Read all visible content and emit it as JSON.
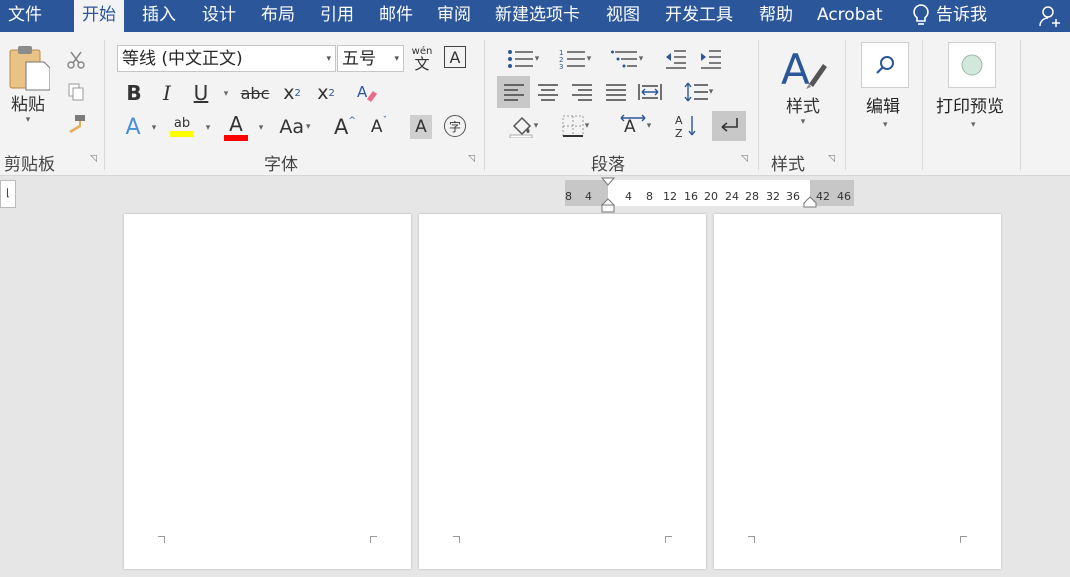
{
  "menu": {
    "tabs": [
      "文件",
      "开始",
      "插入",
      "设计",
      "布局",
      "引用",
      "邮件",
      "审阅",
      "新建选项卡",
      "视图",
      "开发工具",
      "帮助",
      "Acrobat"
    ],
    "tell_me": "告诉我"
  },
  "clipboard": {
    "paste": "粘贴",
    "group": "剪贴板"
  },
  "font": {
    "name": "等线 (中文正文)",
    "size": "五号",
    "phonetic_top": "wén",
    "phonetic_bottom": "文",
    "border_char": "A",
    "bold": "B",
    "italic": "I",
    "underline": "U",
    "strike": "abc",
    "subscript": "x",
    "sub_mark": "2",
    "superscript": "x",
    "sup_mark": "2",
    "text_effect": "A",
    "highlight": "ab",
    "font_color": "A",
    "case": "Aa",
    "grow": "A",
    "shrink": "A",
    "shading": "A",
    "enclose": "字",
    "group": "字体"
  },
  "paragraph": {
    "group": "段落"
  },
  "styles": {
    "label": "样式",
    "group": "样式"
  },
  "editing": {
    "label": "编辑"
  },
  "print_preview": {
    "label": "打印预览"
  },
  "ruler": {
    "numbers": [
      "8",
      "4",
      "4",
      "8",
      "12",
      "16",
      "20",
      "24",
      "28",
      "32",
      "36",
      "42",
      "46"
    ]
  },
  "colors": {
    "accent": "#2b579a",
    "highlight": "#ffff00",
    "font_color": "#ff0000"
  }
}
